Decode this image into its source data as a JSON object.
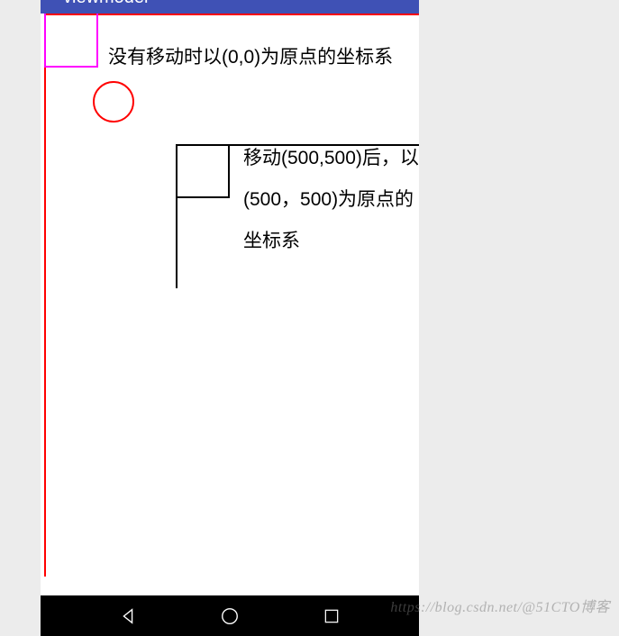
{
  "appbar": {
    "title": "viewmodel"
  },
  "content": {
    "label1": "没有移动时以(0,0)为原点的坐标系",
    "label2": "移动(500,500)后，以(500，500)为原点的坐标系"
  },
  "watermark": {
    "line1": "https://blog.csdn.net/@51CTO博客",
    "line2": "@51CTO博客"
  }
}
